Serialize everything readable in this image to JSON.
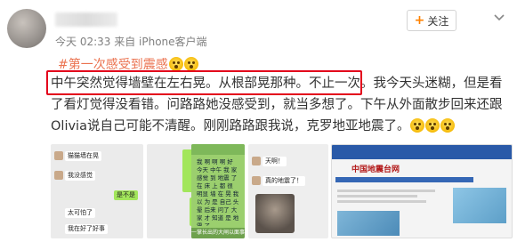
{
  "post": {
    "follow_label": "关注",
    "meta": "今天 02:33 来自 iPhone客户端",
    "hashtag": "#第一次感受到震感",
    "lines": [
      "中午突然觉得墙壁在左右晃。从根部晃那种。不止一次。我今天头迷糊，但是看",
      "了看灯觉得没看错。问路路她没感受到，就当多想了。下午从外面散步回来还跟",
      "Olivia说自己可能不清醒。刚刚路路跟我说，克罗地亚地震了。"
    ]
  },
  "icons": {
    "avatar": "avatar-image",
    "menu": "chevron-down-icon",
    "emoji": "shocked-face-emoji"
  },
  "images": {
    "chat1": [
      "猫猫墙在晃",
      "我没感觉",
      "是不是",
      "太可怕了",
      "我在好了好事"
    ],
    "notes_caption": "一掌长出的大闸以面事",
    "notes_text": "我 啊 啊 啊 好 今天 中午 我 家 感觉 到 地震 了 在 床 上 都 很 明显 墙 在 晃 我 以 为 是 自己 头晕 后来 问了 大家 才 知道 是 地震 了",
    "chat2": [
      "天啊！",
      "真的地震了！"
    ],
    "site_title": "中国地震台网"
  },
  "colors": {
    "highlight_border": "#e3001b",
    "hashtag": "#eb7350",
    "follow_plus": "#ff8200"
  }
}
